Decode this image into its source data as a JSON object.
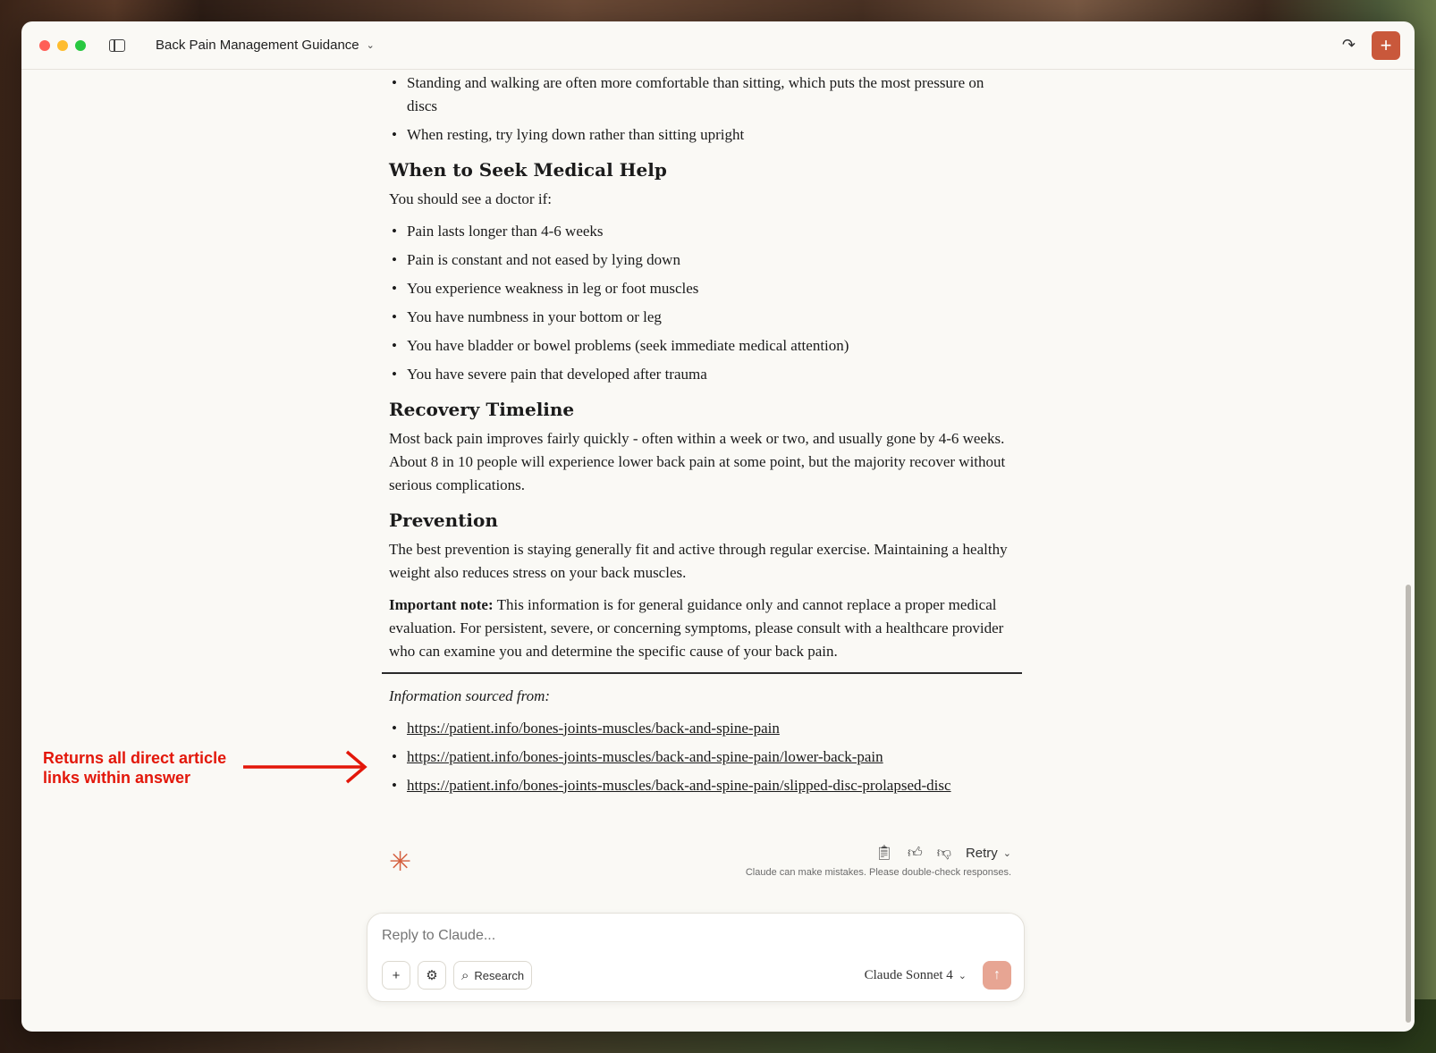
{
  "window": {
    "title": "Back Pain Management Guidance",
    "new_chat_icon": "plus-icon",
    "share_icon": "share-icon"
  },
  "content": {
    "top_bullets": [
      "Standing and walking are often more comfortable than sitting, which puts the most pressure on discs",
      "When resting, try lying down rather than sitting upright"
    ],
    "medical_help": {
      "heading": "When to Seek Medical Help",
      "intro": "You should see a doctor if:",
      "items": [
        "Pain lasts longer than 4-6 weeks",
        "Pain is constant and not eased by lying down",
        "You experience weakness in leg or foot muscles",
        "You have numbness in your bottom or leg",
        "You have bladder or bowel problems (seek immediate medical attention)",
        "You have severe pain that developed after trauma"
      ]
    },
    "recovery": {
      "heading": "Recovery Timeline",
      "text": "Most back pain improves fairly quickly - often within a week or two, and usually gone by 4-6 weeks. About 8 in 10 people will experience lower back pain at some point, but the majority recover without serious complications."
    },
    "prevention": {
      "heading": "Prevention",
      "text": "The best prevention is staying generally fit and active through regular exercise. Maintaining a healthy weight also reduces stress on your back muscles."
    },
    "note": {
      "label": "Important note:",
      "text": " This information is for general guidance only and cannot replace a proper medical evaluation. For persistent, severe, or concerning symptoms, please consult with a healthcare provider who can examine you and determine the specific cause of your back pain."
    },
    "sources": {
      "label": "Information sourced from:",
      "links": [
        "https://patient.info/bones-joints-muscles/back-and-spine-pain",
        "https://patient.info/bones-joints-muscles/back-and-spine-pain/lower-back-pain",
        "https://patient.info/bones-joints-muscles/back-and-spine-pain/slipped-disc-prolapsed-disc"
      ]
    }
  },
  "actions": {
    "retry_label": "Retry",
    "disclaimer": "Claude can make mistakes. Please double-check responses."
  },
  "composer": {
    "placeholder": "Reply to Claude...",
    "research_label": "Research",
    "model": "Claude Sonnet 4"
  },
  "annotation": {
    "text": "Returns all direct article links within answer",
    "color": "#e3170a"
  },
  "colors": {
    "accent": "#c9583b",
    "send_button": "#e7a593",
    "background": "#faf9f5"
  }
}
